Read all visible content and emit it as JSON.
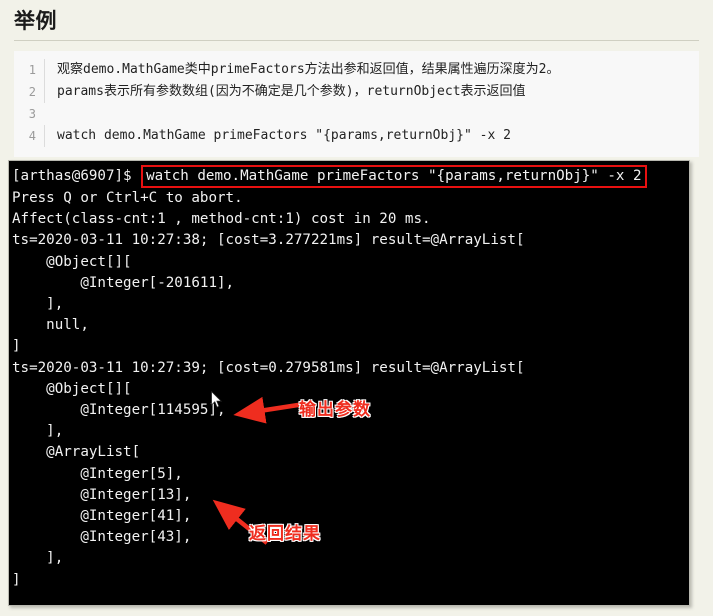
{
  "header": {
    "title": "举例"
  },
  "code_block": {
    "lines": [
      {
        "num": "1",
        "text": "观察demo.MathGame类中primeFactors方法出参和返回值，结果属性遍历深度为2。"
      },
      {
        "num": "2",
        "text": "params表示所有参数数组(因为不确定是几个参数)，returnObject表示返回值"
      },
      {
        "num": "3",
        "text": ""
      },
      {
        "num": "4",
        "text": "watch demo.MathGame primeFactors \"{params,returnObj}\" -x 2"
      }
    ]
  },
  "terminal": {
    "prompt": "[arthas@6907]$ ",
    "command": "watch demo.MathGame primeFactors \"{params,returnObj}\" -x 2",
    "command_highlight_color": "#e81010",
    "lines": [
      "Press Q or Ctrl+C to abort.",
      "Affect(class-cnt:1 , method-cnt:1) cost in 20 ms.",
      "ts=2020-03-11 10:27:38; [cost=3.277221ms] result=@ArrayList[",
      "    @Object[][",
      "        @Integer[-201611],",
      "    ],",
      "    null,",
      "]",
      "ts=2020-03-11 10:27:39; [cost=0.279581ms] result=@ArrayList[",
      "    @Object[][",
      "        @Integer[114595],",
      "    ],",
      "    @ArrayList[",
      "        @Integer[5],",
      "        @Integer[13],",
      "        @Integer[41],",
      "        @Integer[43],",
      "    ],",
      "]"
    ]
  },
  "annotations": [
    {
      "label": "输出参数",
      "color": "#ef2d1f"
    },
    {
      "label": "返回结果",
      "color": "#ef2d1f"
    }
  ]
}
